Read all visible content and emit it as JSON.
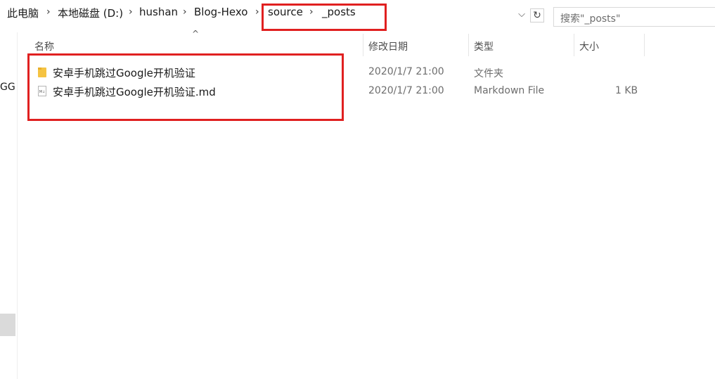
{
  "breadcrumb": {
    "items": [
      "此电脑",
      "本地磁盘 (D:)",
      "hushan",
      "Blog-Hexo",
      "source",
      "_posts"
    ]
  },
  "search": {
    "placeholder": "搜索\"_posts\""
  },
  "left_pane": {
    "truncated_text": "GG"
  },
  "columns": {
    "name": "名称",
    "modified": "修改日期",
    "type": "类型",
    "size": "大小"
  },
  "files": [
    {
      "name": "安卓手机跳过Google开机验证",
      "modified": "2020/1/7 21:00",
      "type": "文件夹",
      "size": "",
      "icon": "folder-icon"
    },
    {
      "name": "安卓手机跳过Google开机验证.md",
      "modified": "2020/1/7 21:00",
      "type": "Markdown File",
      "size": "1 KB",
      "icon": "markdown-file-icon"
    }
  ],
  "colors": {
    "highlight": "#e02020",
    "folder": "#f5c342"
  }
}
